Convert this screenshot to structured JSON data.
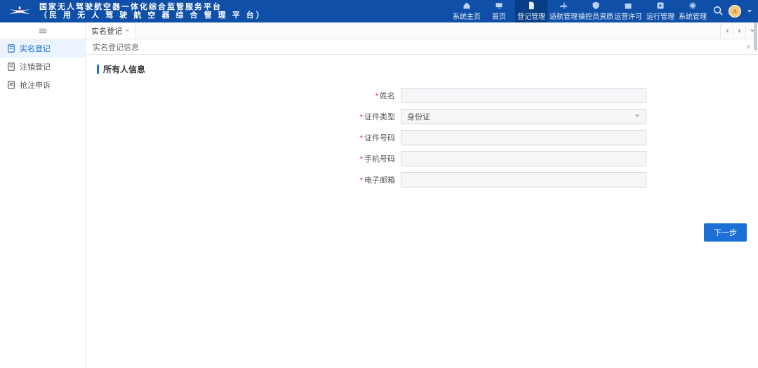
{
  "header": {
    "title_line1": "国家无人驾驶航空器一体化综合监管服务平台",
    "title_line2": "（民 用 无 人 驾 驶 航 空 器 综 合 管 理 平 台）",
    "nav": [
      {
        "label": "系统主页",
        "icon": "home"
      },
      {
        "label": "首页",
        "icon": "monitor"
      },
      {
        "label": "登记管理",
        "icon": "doc",
        "active": true
      },
      {
        "label": "适航管理",
        "icon": "plane"
      },
      {
        "label": "操控员资质",
        "icon": "shield"
      },
      {
        "label": "运营许可",
        "icon": "box"
      },
      {
        "label": "运行管理",
        "icon": "play"
      },
      {
        "label": "系统管理",
        "icon": "gear"
      }
    ],
    "avatar_letter": "a"
  },
  "sidebar": {
    "items": [
      {
        "label": "实名登记",
        "active": true
      },
      {
        "label": "注销登记"
      },
      {
        "label": "抢注申诉"
      }
    ]
  },
  "tabs": {
    "open": [
      {
        "label": "实名登记"
      }
    ]
  },
  "panel": {
    "title": "实名登记信息"
  },
  "section": {
    "title": "所有人信息"
  },
  "form": {
    "fields": {
      "name": {
        "label": "姓名",
        "value": ""
      },
      "id_type": {
        "label": "证件类型",
        "value": "身份证"
      },
      "id_no": {
        "label": "证件号码",
        "value": ""
      },
      "phone": {
        "label": "手机号码",
        "value": ""
      },
      "email": {
        "label": "电子邮箱",
        "value": ""
      }
    },
    "required_mark": "*",
    "next_button": "下一步"
  }
}
